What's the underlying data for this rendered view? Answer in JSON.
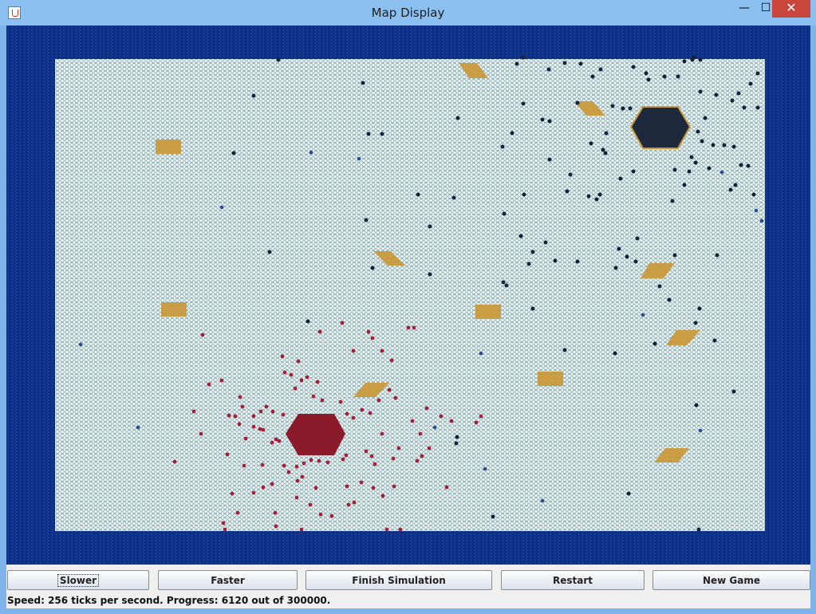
{
  "window": {
    "title": "Map Display",
    "minimize": "—",
    "maximize": "☐",
    "close": "✕"
  },
  "controls": {
    "slower": "Slower",
    "faster": "Faster",
    "finish": "Finish Simulation",
    "restart": "Restart",
    "new_game": "New Game"
  },
  "status": {
    "text": "Speed: 256 ticks per second. Progress: 6120 out of 300000."
  },
  "colors": {
    "sea": "#0b2f82",
    "land": "#ecf6f6",
    "food": "#c89a3c",
    "team_red": "#8b1a2b",
    "team_dark": "#1e2a3c"
  }
}
